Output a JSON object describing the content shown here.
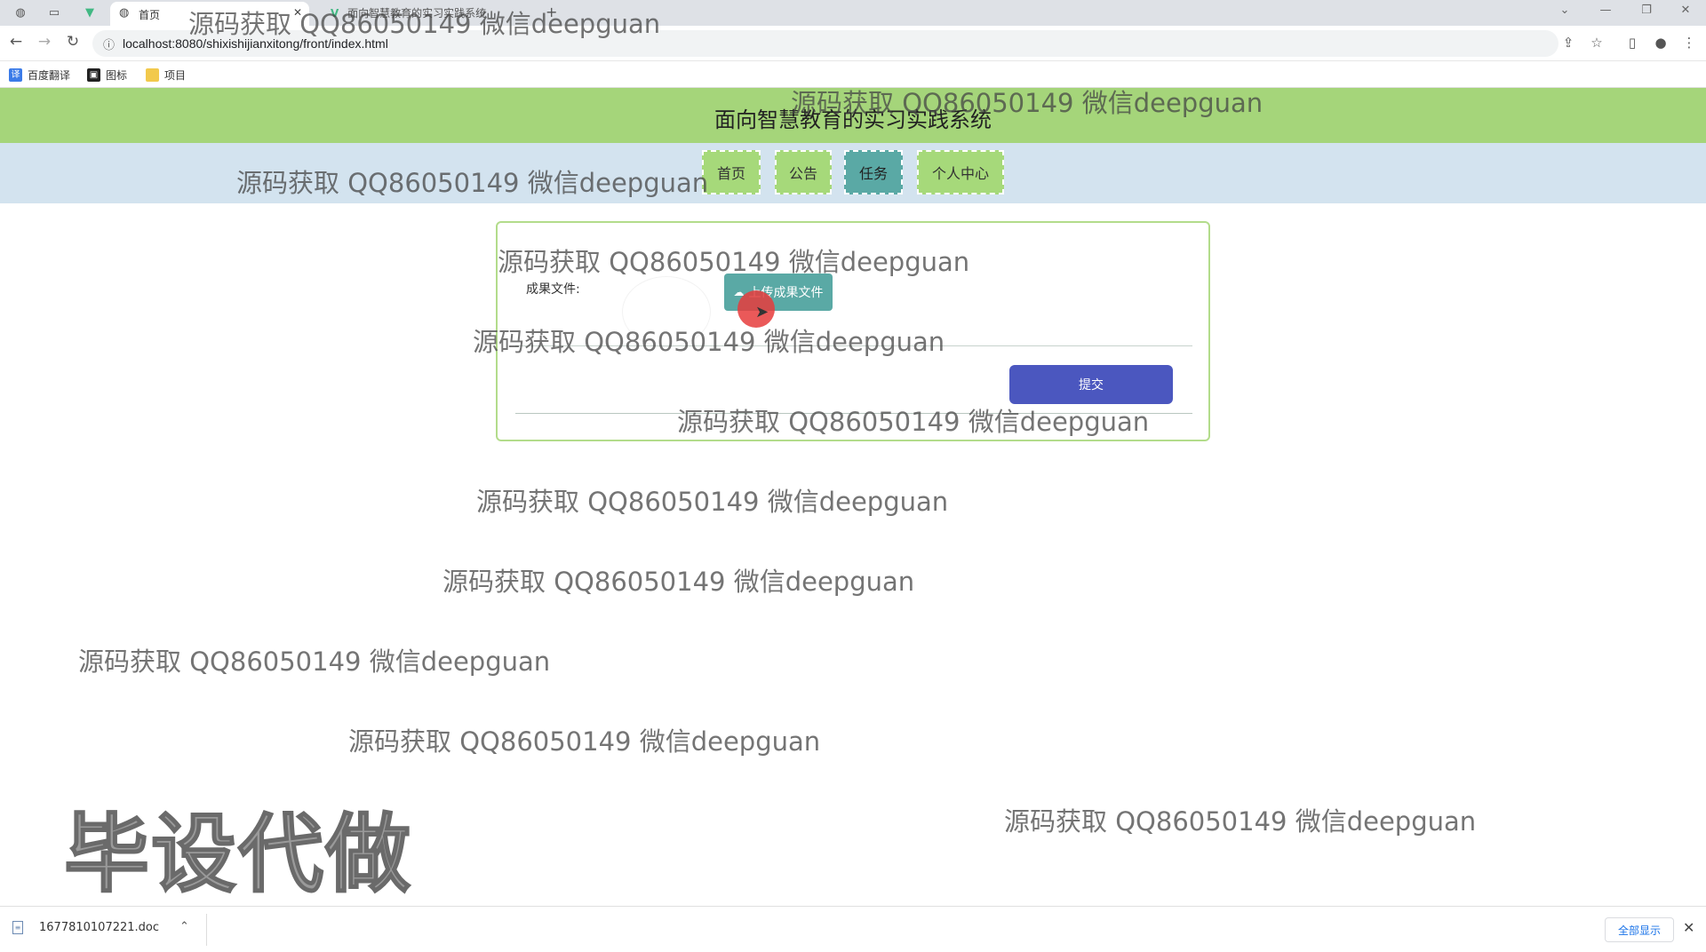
{
  "browser": {
    "active_tab_label": "首页",
    "second_tab_label": "面向智慧教育的实习实践系统",
    "url": "localhost:8080/shixishijianxitong/front/index.html",
    "bookmarks": [
      "百度翻译",
      "图标",
      "项目"
    ]
  },
  "site": {
    "title": "面向智慧教育的实习实践系统",
    "nav": [
      "首页",
      "公告",
      "任务",
      "个人中心"
    ],
    "active_nav": "任务"
  },
  "form": {
    "result_file_label": "成果文件:",
    "upload_button": "上传成果文件",
    "submit_button": "提交"
  },
  "watermark": {
    "text": "源码获取 QQ86050149 微信deepguan",
    "big_text": "毕设代做"
  },
  "download_bar": {
    "file_name": "1677810107221.doc",
    "show_all": "全部显示"
  },
  "colors": {
    "header_bg": "#a5d57a",
    "navbar_bg": "#d3e3ef",
    "nav_item_bg": "#a6d97a",
    "nav_active_bg": "#5aa9a5",
    "upload_btn_bg": "#5aa9a5",
    "submit_btn_bg": "#4b57bf"
  }
}
